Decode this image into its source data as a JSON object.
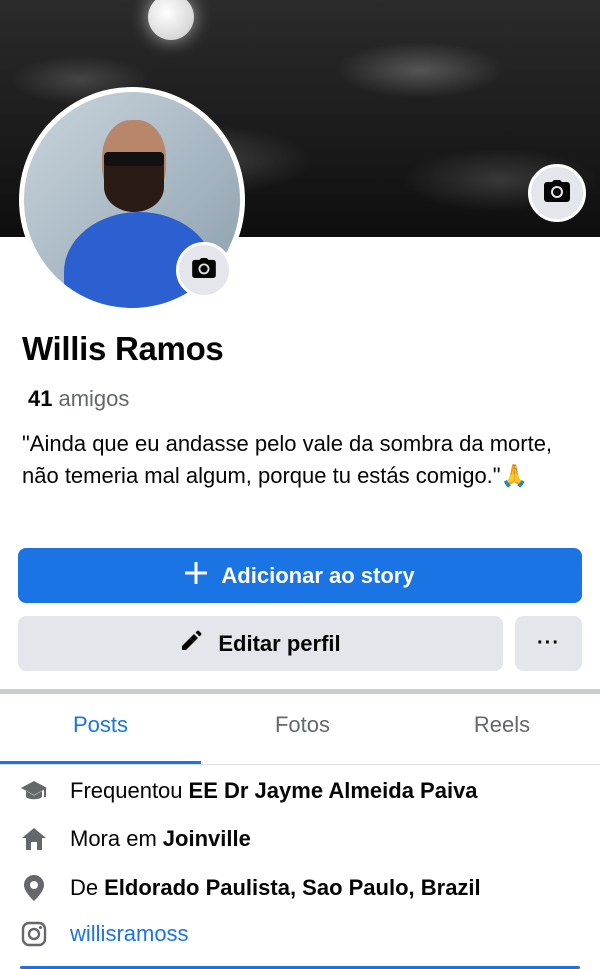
{
  "profile": {
    "name": "Willis Ramos",
    "friends_count": "41",
    "friends_label": "amigos",
    "bio": "\"Ainda que eu andasse pelo vale da sombra da morte, não temeria mal algum, porque tu estás comigo.\"🙏"
  },
  "actions": {
    "add_story_label": "Adicionar ao story",
    "edit_profile_label": "Editar perfil",
    "more_label": "···"
  },
  "tabs": [
    {
      "label": "Posts",
      "active": true
    },
    {
      "label": "Fotos",
      "active": false
    },
    {
      "label": "Reels",
      "active": false
    }
  ],
  "details": {
    "education_prefix": "Frequentou",
    "education_value": "EE Dr Jayme Almeida Paiva",
    "lives_prefix": "Mora em",
    "lives_value": "Joinville",
    "from_prefix": "De",
    "from_value": "Eldorado Paulista, Sao Paulo, Brazil",
    "instagram": "willisramoss"
  },
  "colors": {
    "accent": "#1b74e4",
    "button_gray": "#e4e6eb",
    "secondary_text": "#65676b"
  },
  "icons": [
    "camera-icon",
    "plus-icon",
    "pencil-icon",
    "more-icon",
    "graduation-cap-icon",
    "home-icon",
    "location-pin-icon",
    "instagram-icon"
  ]
}
